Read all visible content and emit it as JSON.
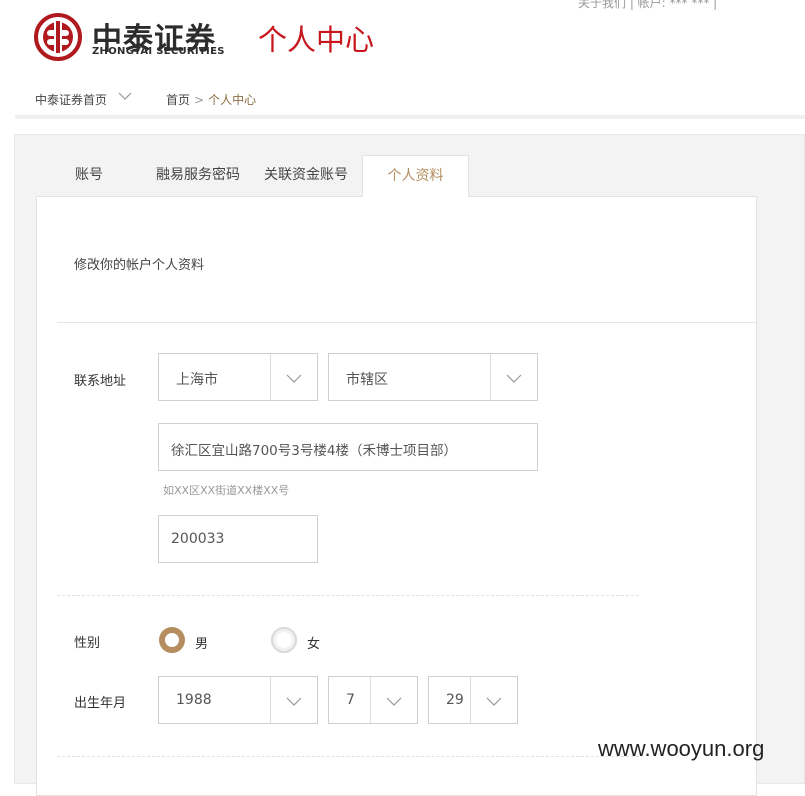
{
  "header": {
    "logo_cn": "中泰证券",
    "logo_en": "ZHONGTAI SECURITIES",
    "page_title": "个人中心",
    "top_links": "关于我们  |  帐户: *** ***  |"
  },
  "nav": {
    "home_dropdown": "中泰证券首页",
    "breadcrumb": {
      "home": "首页",
      "separator": ">",
      "current": "个人中心"
    }
  },
  "tabs": [
    {
      "label": "账号",
      "active": false
    },
    {
      "label": "融易服务密码",
      "active": false
    },
    {
      "label": "关联资金账号",
      "active": false
    },
    {
      "label": "个人资料",
      "active": true
    }
  ],
  "form": {
    "description": "修改你的帐户个人资料",
    "address": {
      "label": "联系地址",
      "province": "上海市",
      "district": "市辖区",
      "street": "徐汇区宜山路700号3号楼4楼（禾博士项目部）",
      "street_hint": "如XX区XX街道XX楼XX号",
      "postcode": "200033"
    },
    "gender": {
      "label": "性别",
      "male": "男",
      "female": "女",
      "selected": "男"
    },
    "birth": {
      "label": "出生年月",
      "year": "1988",
      "month": "7",
      "day": "29"
    }
  },
  "watermark": "www.wooyun.org",
  "colors": {
    "brand_red": "#c8161d",
    "accent_gold": "#b48e5e",
    "nav_underline": "#8f6d44"
  }
}
